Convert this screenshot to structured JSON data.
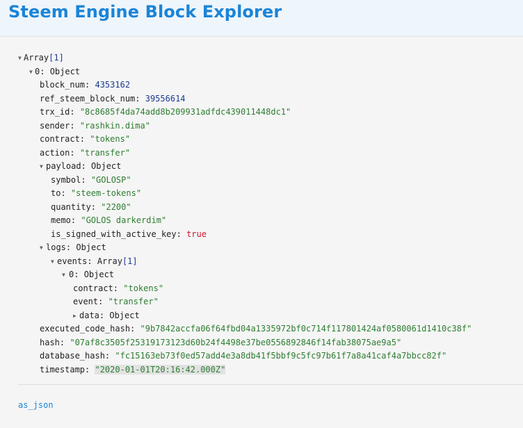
{
  "header": {
    "title": "Steem Engine Block Explorer"
  },
  "tree": {
    "root_label": "Array",
    "root_count": "[1]",
    "item0_key": "0",
    "object_type": "Object",
    "array_type": "Array",
    "fields": {
      "block_num": {
        "key": "block_num",
        "value": "4353162"
      },
      "ref_steem_block_num": {
        "key": "ref_steem_block_num",
        "value": "39556614"
      },
      "trx_id": {
        "key": "trx_id",
        "value": "\"8c8685f4da74add8b209931adfdc439011448dc1\""
      },
      "sender": {
        "key": "sender",
        "value": "\"rashkin.dima\""
      },
      "contract": {
        "key": "contract",
        "value": "\"tokens\""
      },
      "action": {
        "key": "action",
        "value": "\"transfer\""
      },
      "payload": {
        "key": "payload"
      },
      "symbol": {
        "key": "symbol",
        "value": "\"GOLOSP\""
      },
      "to": {
        "key": "to",
        "value": "\"steem-tokens\""
      },
      "quantity": {
        "key": "quantity",
        "value": "\"2200\""
      },
      "memo": {
        "key": "memo",
        "value": "\"GOLOS darkerdim\""
      },
      "is_signed_with_active_key": {
        "key": "is_signed_with_active_key",
        "value": "true"
      },
      "logs": {
        "key": "logs"
      },
      "events": {
        "key": "events",
        "count": "[1]"
      },
      "event0": {
        "key": "0"
      },
      "ev_contract": {
        "key": "contract",
        "value": "\"tokens\""
      },
      "ev_event": {
        "key": "event",
        "value": "\"transfer\""
      },
      "ev_data": {
        "key": "data"
      },
      "executed_code_hash": {
        "key": "executed_code_hash",
        "value": "\"9b7842accfa06f64fbd04a1335972bf0c714f117801424af0580061d1410c38f\""
      },
      "hash": {
        "key": "hash",
        "value": "\"07af8c3505f25319173123d60b24f4498e37be0556892846f14fab38075ae9a5\""
      },
      "database_hash": {
        "key": "database_hash",
        "value": "\"fc15163eb73f0ed57add4e3a8db41f5bbf9c5fc97b61f7a8a41caf4a7bbcc82f\""
      },
      "timestamp": {
        "key": "timestamp",
        "value": "\"2020-01-01T20:16:42.000Z\""
      }
    }
  },
  "footer": {
    "link": "as_json"
  },
  "icons": {
    "expanded": "triangle-down-icon",
    "collapsed": "triangle-right-icon"
  },
  "colors": {
    "title": "#1a84d8",
    "string": "#2e7d32",
    "number": "#1b3a8f",
    "boolean": "#d0132c"
  }
}
